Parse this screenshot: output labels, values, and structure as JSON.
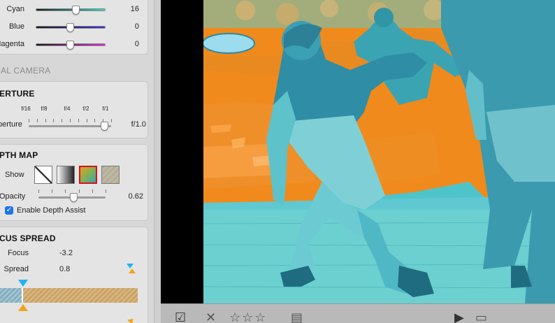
{
  "color_sliders": [
    {
      "label": "Cyan",
      "value": "16",
      "position": 0.58,
      "gradient": [
        "#1a1a1a",
        "#28e0d0"
      ]
    },
    {
      "label": "Blue",
      "value": "0",
      "position": 0.5,
      "gradient": [
        "#1a1a1a",
        "#3c2fd8"
      ]
    },
    {
      "label": "Magenta",
      "value": "0",
      "position": 0.5,
      "gradient": [
        "#1a1a1a",
        "#e326d9"
      ]
    }
  ],
  "group_title": "UAL CAMERA",
  "aperture": {
    "title": "ERTURE",
    "label": "perture",
    "value": "f/1.0",
    "position": 0.92,
    "ticks": [
      "f/16",
      "f/8",
      "f/4",
      "f/2",
      "f/1"
    ]
  },
  "depth_map": {
    "title": "PTH MAP",
    "show_label": "Show",
    "selected_mode": 3,
    "opacity_label": "Opacity",
    "opacity_value": "0.62",
    "opacity_position": 0.62,
    "enable_assist_label": "Enable Depth Assist",
    "enable_assist_checked": true
  },
  "focus_spread": {
    "title": "CUS SPREAD",
    "focus_label": "Focus",
    "focus_value": "-3.2",
    "spread_label": "Spread",
    "spread_value": "0.8"
  },
  "toolbar": {
    "checkmark": "☑",
    "reject": "✕",
    "stars": "☆☆☆",
    "notes": "▤",
    "play": "▶",
    "slideshow": "▭"
  },
  "colors": {
    "sidebar_bg": "#d7d7d7",
    "panel_bg": "#e4e4e4",
    "focus_marker": "#1fb4f0",
    "spread_marker": "#f4a31a",
    "depth_near": "#f08a1c",
    "depth_far": "#4ac1c9"
  }
}
